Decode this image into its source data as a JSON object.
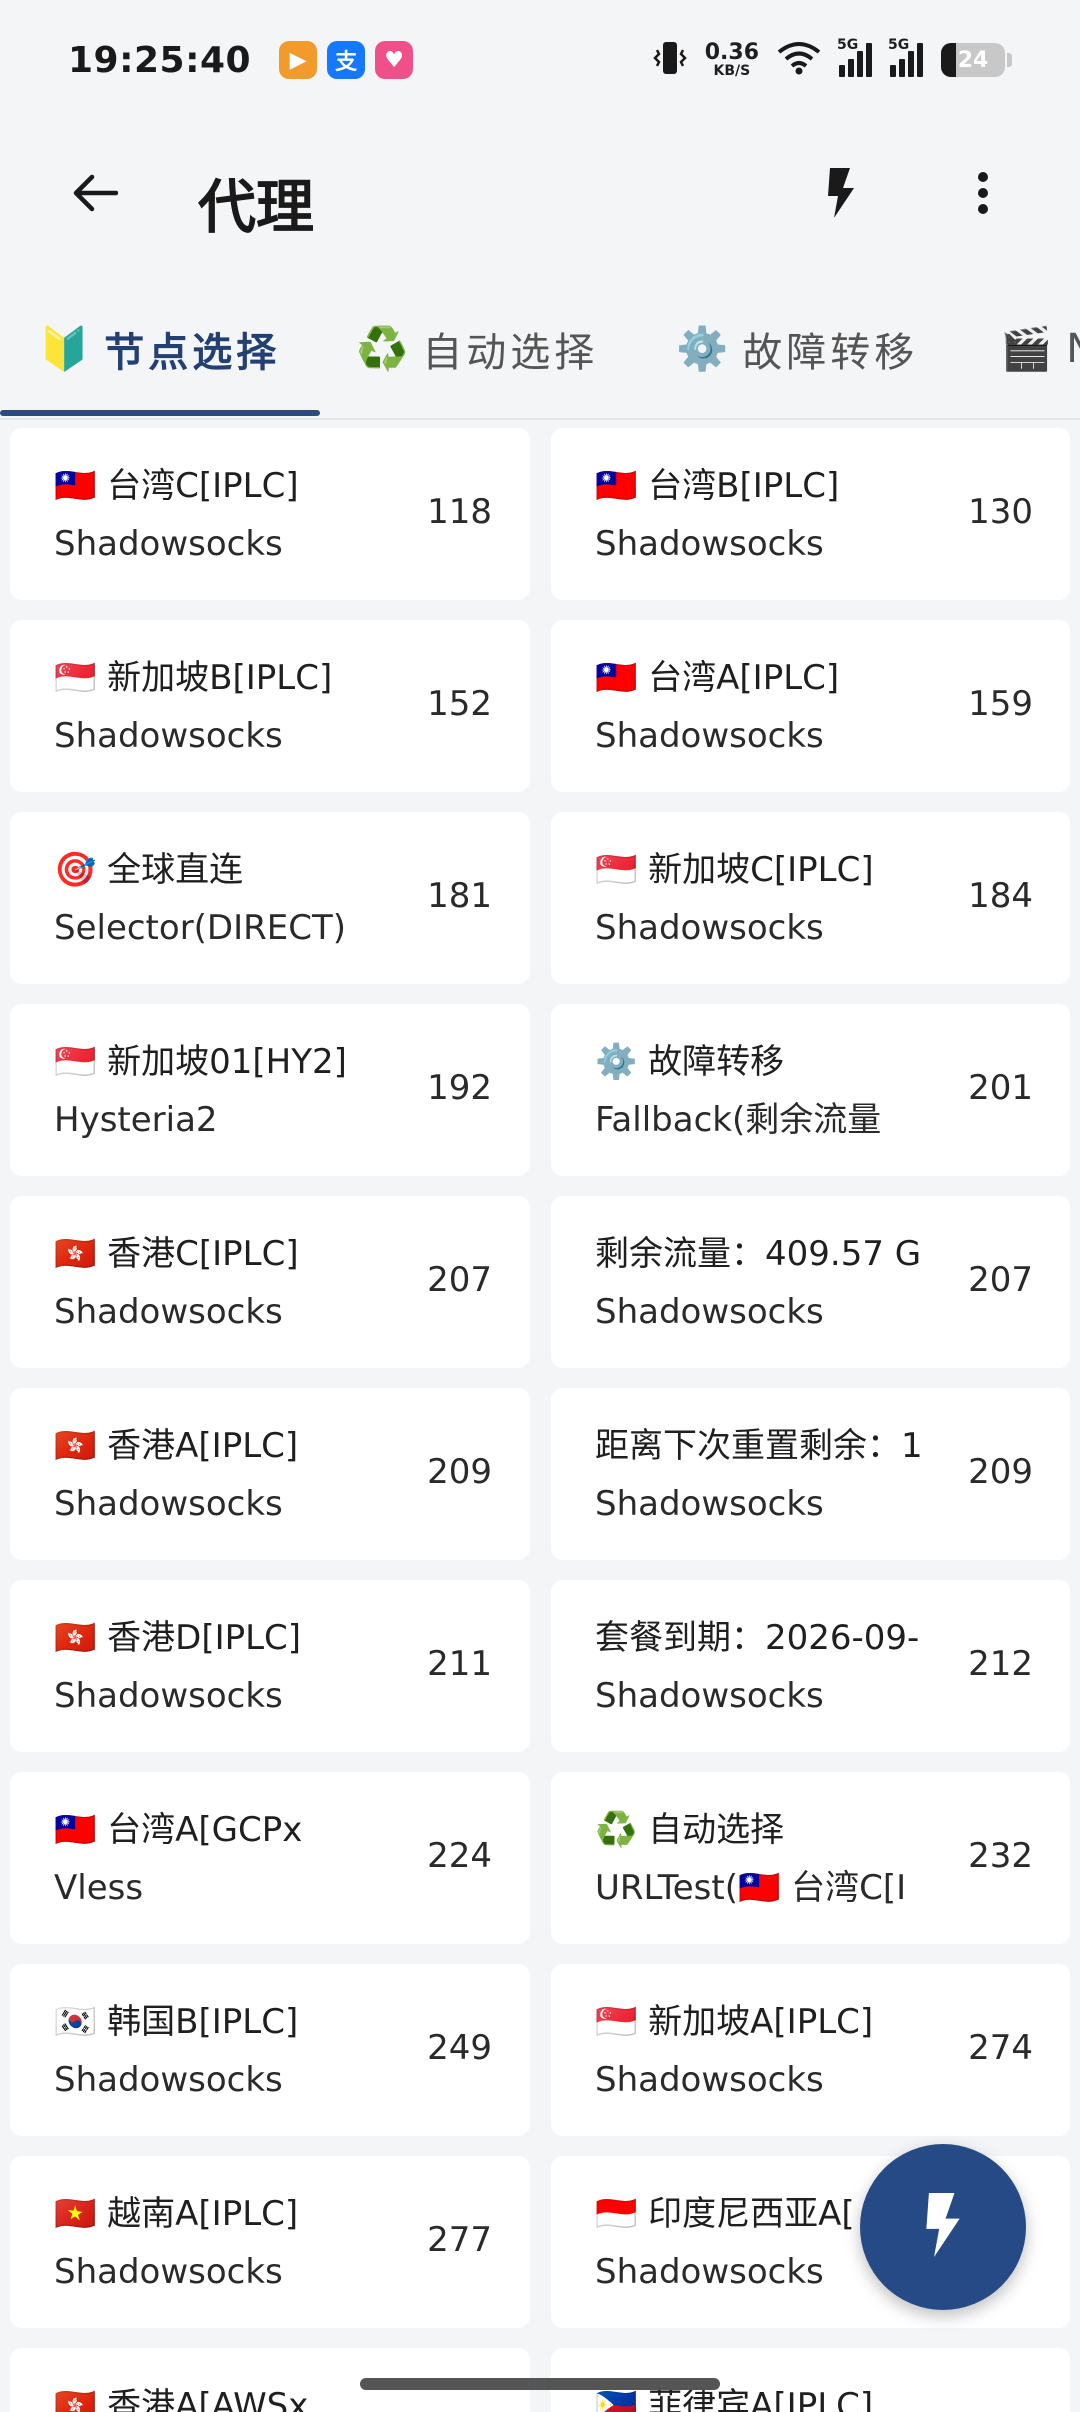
{
  "status_bar": {
    "time": "19:25:40",
    "apps": [
      {
        "icon": "video-app-icon",
        "glyph": "▶",
        "color": "#f39a2d"
      },
      {
        "icon": "alipay-icon",
        "glyph": "支",
        "color": "#1677ff"
      },
      {
        "icon": "shop-app-icon",
        "glyph": "♥",
        "color": "#f0508a"
      }
    ],
    "net_speed_value": "0.36",
    "net_speed_unit": "KB/S",
    "sim1_tag": "5G",
    "sim2_tag": "5G",
    "battery_level": "24"
  },
  "app_bar": {
    "title": "代理",
    "back_icon": "arrow-left-icon",
    "bolt_icon": "lightning-icon",
    "more_icon": "more-vertical-icon"
  },
  "tabs": [
    {
      "icon": "🔰",
      "label": "节点选择",
      "active": true
    },
    {
      "icon": "♻️",
      "label": "自动选择",
      "active": false
    },
    {
      "icon": "⚙️",
      "label": "故障转移",
      "active": false
    },
    {
      "icon": "🎬",
      "label": "N",
      "active": false
    }
  ],
  "proxies": [
    {
      "name": "🇹🇼 台湾C[IPLC]",
      "type": "Shadowsocks",
      "delay": "118"
    },
    {
      "name": "🇹🇼 台湾B[IPLC]",
      "type": "Shadowsocks",
      "delay": "130"
    },
    {
      "name": "🇸🇬 新加坡B[IPLC]",
      "type": "Shadowsocks",
      "delay": "152"
    },
    {
      "name": "🇹🇼 台湾A[IPLC]",
      "type": "Shadowsocks",
      "delay": "159"
    },
    {
      "name": "🎯 全球直连",
      "type": "Selector(DIRECT)",
      "delay": "181"
    },
    {
      "name": "🇸🇬 新加坡C[IPLC]",
      "type": "Shadowsocks",
      "delay": "184"
    },
    {
      "name": "🇸🇬 新加坡01[HY2]",
      "type": "Hysteria2",
      "delay": "192"
    },
    {
      "name": "⚙️ 故障转移",
      "type": "Fallback(剩余流量",
      "delay": "201"
    },
    {
      "name": "🇭🇰 香港C[IPLC]",
      "type": "Shadowsocks",
      "delay": "207"
    },
    {
      "name": "剩余流量：409.57 G",
      "type": "Shadowsocks",
      "delay": "207"
    },
    {
      "name": "🇭🇰 香港A[IPLC]",
      "type": "Shadowsocks",
      "delay": "209"
    },
    {
      "name": "距离下次重置剩余：1",
      "type": "Shadowsocks",
      "delay": "209"
    },
    {
      "name": "🇭🇰 香港D[IPLC]",
      "type": "Shadowsocks",
      "delay": "211"
    },
    {
      "name": "套餐到期：2026-09-",
      "type": "Shadowsocks",
      "delay": "212"
    },
    {
      "name": "🇹🇼 台湾A[GCPx",
      "type": "Vless",
      "delay": "224"
    },
    {
      "name": "♻️ 自动选择",
      "type": "URLTest(🇹🇼 台湾C[I",
      "delay": "232"
    },
    {
      "name": "🇰🇷 韩国B[IPLC]",
      "type": "Shadowsocks",
      "delay": "249"
    },
    {
      "name": "🇸🇬 新加坡A[IPLC]",
      "type": "Shadowsocks",
      "delay": "274"
    },
    {
      "name": "🇻🇳 越南A[IPLC]",
      "type": "Shadowsocks",
      "delay": "277"
    },
    {
      "name": "🇮🇩 印度尼西亚A[",
      "type": "Shadowsocks",
      "delay": ""
    },
    {
      "name": "🇭🇰 香港A[AWSx",
      "type": "",
      "delay": ""
    },
    {
      "name": "🇵🇭 菲律宾A[IPLC]",
      "type": "",
      "delay": ""
    }
  ],
  "fab": {
    "icon": "lightning-icon"
  }
}
